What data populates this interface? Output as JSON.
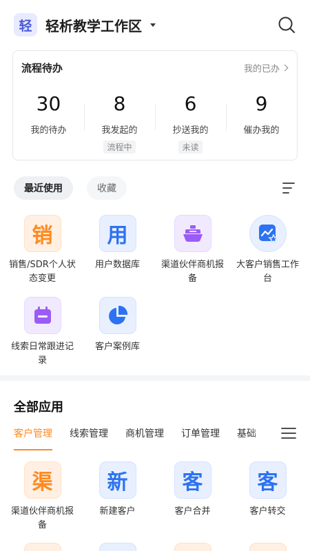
{
  "header": {
    "logo_text": "轻",
    "workspace_title": "轻析教学工作区",
    "search_icon": "search-icon"
  },
  "flow": {
    "title": "流程待办",
    "link_label": "我的已办",
    "stats": [
      {
        "value": "30",
        "label": "我的待办",
        "badge": ""
      },
      {
        "value": "8",
        "label": "我发起的",
        "badge": "流程中"
      },
      {
        "value": "6",
        "label": "抄送我的",
        "badge": "未读"
      },
      {
        "value": "9",
        "label": "催办我的",
        "badge": ""
      }
    ]
  },
  "recent": {
    "tab_recent": "最近使用",
    "tab_favorites": "收藏",
    "apps": [
      {
        "label": "销售/SDR个人状态变更",
        "glyph": "销",
        "color": "orange",
        "icon": "text-icon"
      },
      {
        "label": "用户数据库",
        "glyph": "用",
        "color": "blue",
        "icon": "text-icon"
      },
      {
        "label": "渠道伙伴商机报备",
        "glyph": "",
        "color": "purple",
        "icon": "ship-icon"
      },
      {
        "label": "大客户销售工作台",
        "glyph": "",
        "color": "blue",
        "icon": "chart-star-icon"
      },
      {
        "label": "线索日常跟进记录",
        "glyph": "",
        "color": "purple",
        "icon": "calendar-icon"
      },
      {
        "label": "客户案例库",
        "glyph": "",
        "color": "blue",
        "icon": "pie-chart-icon"
      }
    ]
  },
  "all_apps": {
    "title": "全部应用",
    "tabs": [
      "客户管理",
      "线索管理",
      "商机管理",
      "订单管理",
      "基础"
    ],
    "active_tab": 0,
    "apps": [
      {
        "label": "渠道伙伴商机报备",
        "glyph": "渠",
        "color": "orange"
      },
      {
        "label": "新建客户",
        "glyph": "新",
        "color": "blue"
      },
      {
        "label": "客户合并",
        "glyph": "客",
        "color": "blue"
      },
      {
        "label": "客户转交",
        "glyph": "客",
        "color": "blue"
      }
    ]
  },
  "colors": {
    "accent": "#ff8a1f",
    "blue": "#2d72f0",
    "purple": "#9b5cf6"
  }
}
